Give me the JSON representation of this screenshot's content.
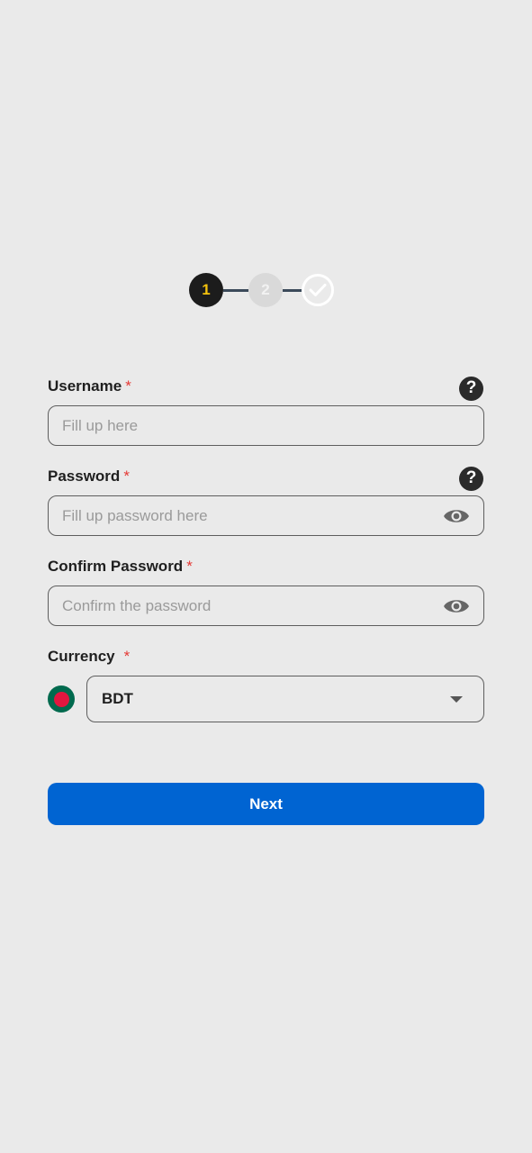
{
  "stepper": {
    "steps": [
      {
        "label": "1",
        "state": "active"
      },
      {
        "label": "2",
        "state": "inactive"
      },
      {
        "label": "",
        "state": "done",
        "icon": "check-circle-icon"
      }
    ]
  },
  "form": {
    "username": {
      "label": "Username",
      "required_mark": "*",
      "placeholder": "Fill up here",
      "value": "",
      "help_icon": "?"
    },
    "password": {
      "label": "Password",
      "required_mark": "*",
      "placeholder": "Fill up password here",
      "value": "",
      "help_icon": "?",
      "toggle_icon": "eye-icon"
    },
    "confirm_password": {
      "label": "Confirm Password",
      "required_mark": "*",
      "placeholder": "Confirm the password",
      "value": "",
      "toggle_icon": "eye-icon"
    },
    "currency": {
      "label": "Currency",
      "required_mark": "*",
      "selected": "BDT",
      "flag": "bangladesh-flag-icon"
    }
  },
  "actions": {
    "next_label": "Next"
  },
  "colors": {
    "background": "#eaeaea",
    "primary": "#0064d2",
    "step_active_bg": "#1c1c1c",
    "step_active_text": "#f4c20d",
    "required": "#e53935"
  }
}
